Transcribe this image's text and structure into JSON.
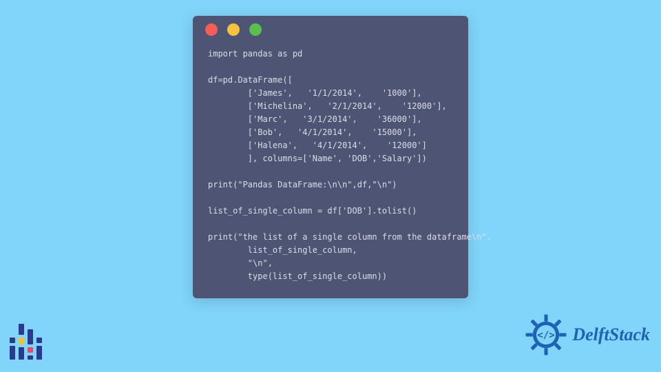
{
  "code": {
    "lines": [
      "import pandas as pd",
      "",
      "df=pd.DataFrame([",
      "        ['James',   '1/1/2014',    '1000'],",
      "        ['Michelina',   '2/1/2014',    '12000'],",
      "        ['Marc',   '3/1/2014',    '36000'],",
      "        ['Bob',   '4/1/2014',    '15000'],",
      "        ['Halena',   '4/1/2014',    '12000']",
      "        ], columns=['Name', 'DOB','Salary'])",
      "",
      "print(\"Pandas DataFrame:\\n\\n\",df,\"\\n\")",
      "",
      "list_of_single_column = df['DOB'].tolist()",
      "",
      "print(\"the list of a single column from the dataframe\\n\",",
      "        list_of_single_column,",
      "        \"\\n\",",
      "        type(list_of_single_column))"
    ]
  },
  "brand": {
    "name": "DelftStack"
  },
  "colors": {
    "bg": "#81d4fa",
    "panel": "#4e5574",
    "brand_blue": "#1e62b3"
  }
}
